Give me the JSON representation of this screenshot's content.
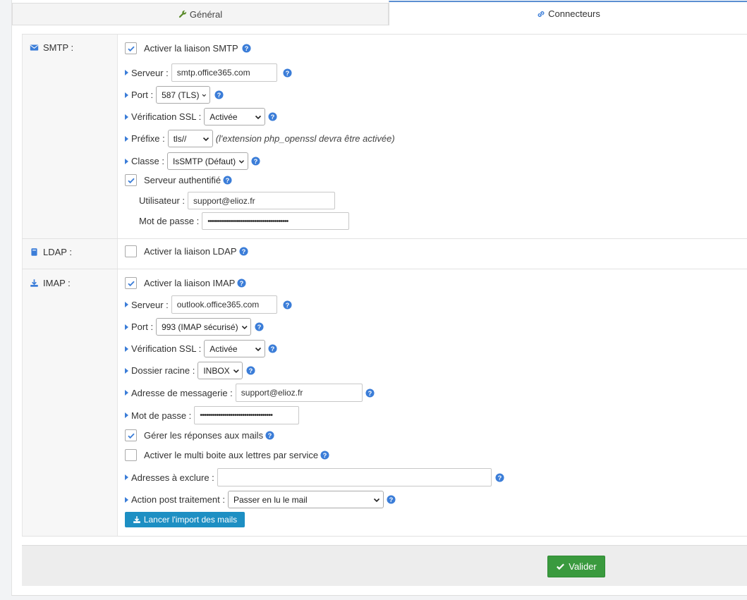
{
  "tabs": {
    "general": "Général",
    "connectors": "Connecteurs"
  },
  "smtp": {
    "section_label": "SMTP :",
    "enable_label": "Activer la liaison SMTP",
    "enabled": true,
    "server_label": "Serveur :",
    "server_value": "smtp.office365.com",
    "port_label": "Port :",
    "port_value": "587 (TLS)",
    "ssl_label": "Vérification SSL :",
    "ssl_value": "Activée",
    "prefix_label": "Préfixe :",
    "prefix_value": "tls//",
    "prefix_note": "(l'extension php_openssl devra être activée)",
    "class_label": "Classe :",
    "class_value": "IsSMTP (Défaut)",
    "auth_label": "Serveur authentifié",
    "auth_enabled": true,
    "user_label": "Utilisateur :",
    "user_value": "support@elioz.fr",
    "password_label": "Mot de passe :",
    "password_value": "••••••••••••••••••••••••••••••••••••••••"
  },
  "ldap": {
    "section_label": "LDAP :",
    "enable_label": "Activer la liaison LDAP",
    "enabled": false
  },
  "imap": {
    "section_label": "IMAP :",
    "enable_label": "Activer la liaison IMAP",
    "enabled": true,
    "server_label": "Serveur :",
    "server_value": "outlook.office365.com",
    "port_label": "Port :",
    "port_value": "993 (IMAP sécurisé)",
    "ssl_label": "Vérification SSL :",
    "ssl_value": "Activée",
    "folder_label": "Dossier racine :",
    "folder_value": "INBOX",
    "email_label": "Adresse de messagerie :",
    "email_value": "support@elioz.fr",
    "password_label": "Mot de passe :",
    "password_value": "••••••••••••••••••••••••••••••••••••",
    "replies_label": "Gérer les réponses aux mails",
    "replies_enabled": true,
    "multi_label": "Activer le multi boite aux lettres par service",
    "multi_enabled": false,
    "exclude_label": "Adresses à exclure :",
    "exclude_value": "",
    "action_label": "Action post traitement :",
    "action_value": "Passer en lu le mail",
    "import_button": "Lancer l'import des mails"
  },
  "footer": {
    "validate_button": "Valider"
  },
  "colors": {
    "accent": "#3b7dd8",
    "import_button": "#1d8fc3",
    "validate_button": "#3a9a3e"
  }
}
